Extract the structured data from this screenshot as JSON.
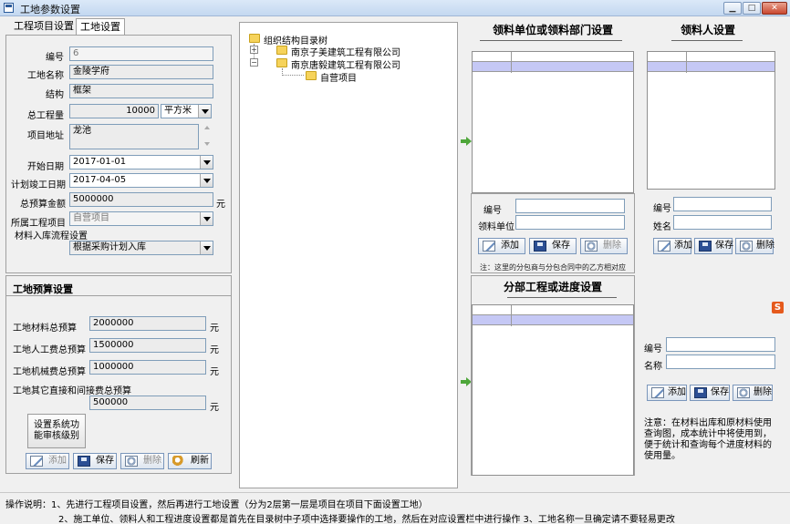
{
  "window": {
    "title": "工地参数设置",
    "min_label": "▁",
    "max_label": "□",
    "close_label": "✕"
  },
  "tabs": [
    {
      "label": "工程项目设置"
    },
    {
      "label": "工地设置"
    }
  ],
  "site_form": {
    "code_label": "编号",
    "code_value": "6",
    "name_label": "工地名称",
    "name_value": "金陵学府",
    "structure_label": "结构",
    "structure_value": "框架",
    "quantity_label": "总工程量",
    "quantity_value": "10000",
    "unit_value": "平方米",
    "address_label": "项目地址",
    "address_value": "龙池",
    "start_label": "开始日期",
    "start_value": "2017-01-01",
    "end_label": "计划竣工日期",
    "end_value": "2017-04-05",
    "budget_label": "总预算金额",
    "budget_value": "5000000",
    "budget_unit": "元",
    "project_label": "所属工程项目",
    "project_value": "自营项目",
    "flow_label": "材料入库流程设置",
    "flow_value": "根据采购计划入库"
  },
  "budget_section": {
    "title": "工地预算设置",
    "material_label": "工地材料总预算",
    "material_value": "2000000",
    "labor_label": "工地人工费总预算",
    "labor_value": "1500000",
    "machine_label": "工地机械费总预算",
    "machine_value": "1000000",
    "other_label": "工地其它直接和间接费总预算",
    "other_value": "500000",
    "unit": "元",
    "audit_button": "设置系统功能审核级别"
  },
  "left_buttons": {
    "add": "添加",
    "save": "保存",
    "delete": "删除",
    "refresh": "刷新"
  },
  "tree": {
    "root": "组织结构目录树",
    "nodes": [
      {
        "label": "南京子美建筑工程有限公司",
        "expander": "+"
      },
      {
        "label": "南京唐毅建筑工程有限公司",
        "expander": "−"
      },
      {
        "label": "自营项目",
        "expander": ""
      }
    ]
  },
  "dept_panel": {
    "title": "领料单位或领料部门设置",
    "code_label": "编号",
    "unit_label": "领料单位",
    "add": "添加",
    "save": "保存",
    "delete": "删除",
    "note": "注：这里的分包商与分包合同中的乙方相对应"
  },
  "person_panel": {
    "title": "领料人设置",
    "code_label": "编号",
    "name_label": "姓名",
    "add": "添加",
    "save": "保存",
    "delete": "删除"
  },
  "progress_panel": {
    "title": "分部工程或进度设置",
    "code_label": "编号",
    "name_label": "名称",
    "add": "添加",
    "save": "保存",
    "delete": "删除",
    "note": "注意：在材料出库和原材料使用查询图，成本统计中将使用到，便于统计和查询每个进度材料的使用量。"
  },
  "instructions": {
    "line1": "操作说明：1、先进行工程项目设置，然后再进行工地设置（分为2层第一层是项目在项目下面设置工地）",
    "line2": "2、施工单位、领料人和工程进度设置都是首先在目录树中子项中选择要操作的工地，然后在对应设置栏中进行操作   3、工地名称一旦确定请不要轻易更改"
  },
  "side_badge": "S"
}
